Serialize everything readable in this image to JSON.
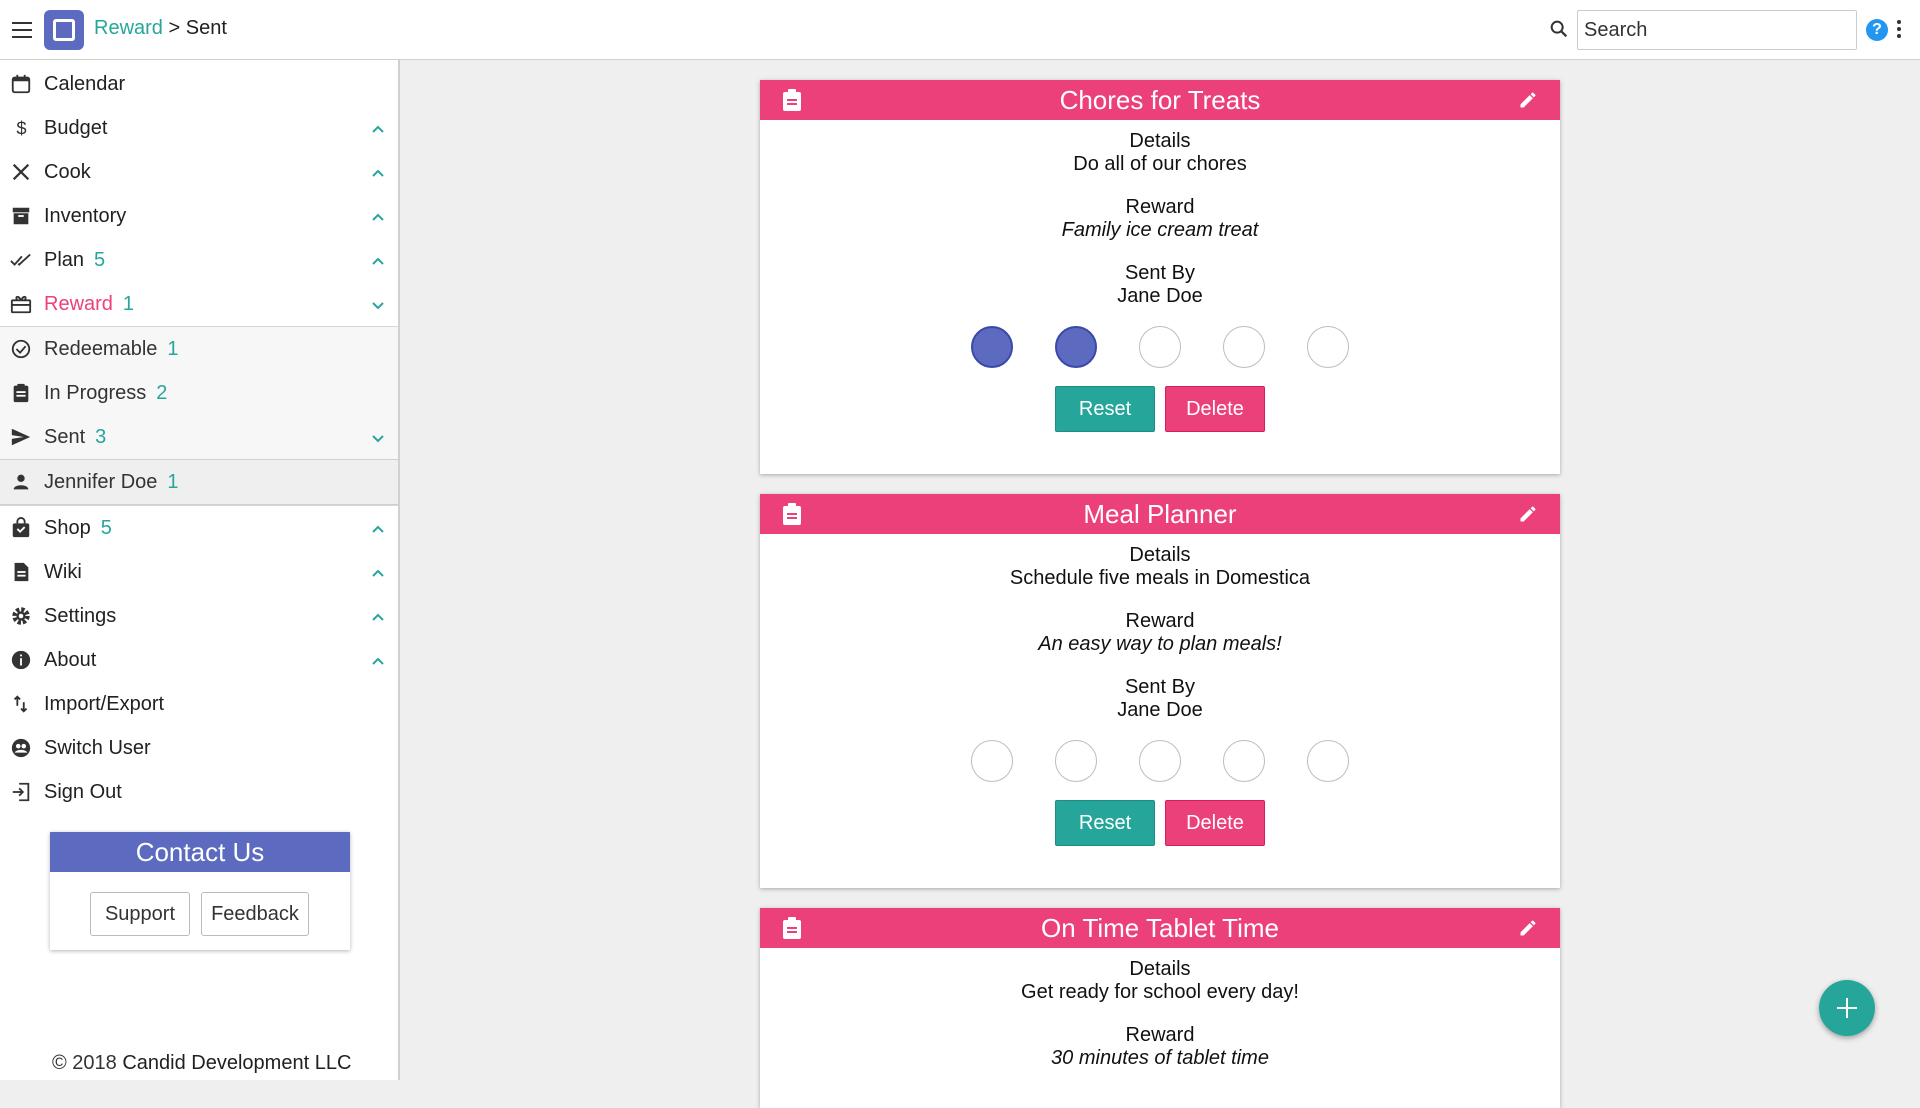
{
  "header": {
    "breadcrumb_parent": "Reward",
    "breadcrumb_sep": ">",
    "breadcrumb_current": "Sent",
    "search_placeholder": "Search",
    "help_label": "?"
  },
  "sidebar": {
    "items": [
      {
        "label": "Calendar",
        "count": "",
        "icon": "calendar-icon"
      },
      {
        "label": "Budget",
        "count": "",
        "icon": "dollar-icon"
      },
      {
        "label": "Cook",
        "count": "",
        "icon": "utensils-icon"
      },
      {
        "label": "Inventory",
        "count": "",
        "icon": "archive-icon"
      },
      {
        "label": "Plan",
        "count": "5",
        "icon": "double-check-icon"
      },
      {
        "label": "Reward",
        "count": "1",
        "icon": "gift-icon"
      },
      {
        "label": "Redeemable",
        "count": "1",
        "icon": "check-circle-icon"
      },
      {
        "label": "In Progress",
        "count": "2",
        "icon": "clipboard-icon"
      },
      {
        "label": "Sent",
        "count": "3",
        "icon": "send-icon"
      },
      {
        "label": "Jennifer Doe",
        "count": "1",
        "icon": "person-icon"
      },
      {
        "label": "Shop",
        "count": "5",
        "icon": "shopping-bag-icon"
      },
      {
        "label": "Wiki",
        "count": "",
        "icon": "document-icon"
      },
      {
        "label": "Settings",
        "count": "",
        "icon": "gear-icon"
      },
      {
        "label": "About",
        "count": "",
        "icon": "info-icon"
      },
      {
        "label": "Import/Export",
        "count": "",
        "icon": "import-export-icon"
      },
      {
        "label": "Switch User",
        "count": "",
        "icon": "switch-user-icon"
      },
      {
        "label": "Sign Out",
        "count": "",
        "icon": "sign-out-icon"
      }
    ],
    "contact": {
      "title": "Contact Us",
      "support": "Support",
      "feedback": "Feedback"
    },
    "copyright_prefix": "© 2018",
    "copyright_company": "Candid Development LLC"
  },
  "labels": {
    "details": "Details",
    "reward": "Reward",
    "sent_by": "Sent By",
    "reset": "Reset",
    "delete": "Delete"
  },
  "cards": [
    {
      "title": "Chores for Treats",
      "details": "Do all of our chores",
      "reward": "Family ice cream treat",
      "sent_by": "Jane Doe",
      "progress_filled": 2,
      "progress_total": 5
    },
    {
      "title": "Meal Planner",
      "details": "Schedule five meals in Domestica",
      "reward": "An easy way to plan meals!",
      "sent_by": "Jane Doe",
      "progress_filled": 0,
      "progress_total": 5
    },
    {
      "title": "On Time Tablet Time",
      "details": "Get ready for school every day!",
      "reward": "30 minutes of tablet time"
    }
  ],
  "colors": {
    "primary": "#5c6bc0",
    "accent": "#ec407a",
    "teal": "#26a69a"
  }
}
